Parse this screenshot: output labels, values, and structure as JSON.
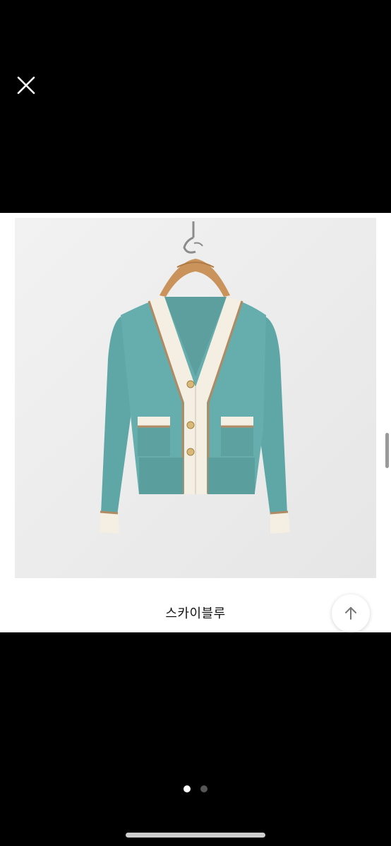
{
  "viewer": {
    "close_icon": "close-icon",
    "background_color": "#000000"
  },
  "product": {
    "caption": "스카이블루",
    "photo_subject": "product-photo",
    "sweater_color": "#5fa6a6",
    "trim_color": "#f4efe2",
    "stripe_color": "#b08a62"
  },
  "scroll_top": {
    "icon": "arrow-up-icon"
  },
  "pager": {
    "total": 2,
    "current": 1
  }
}
